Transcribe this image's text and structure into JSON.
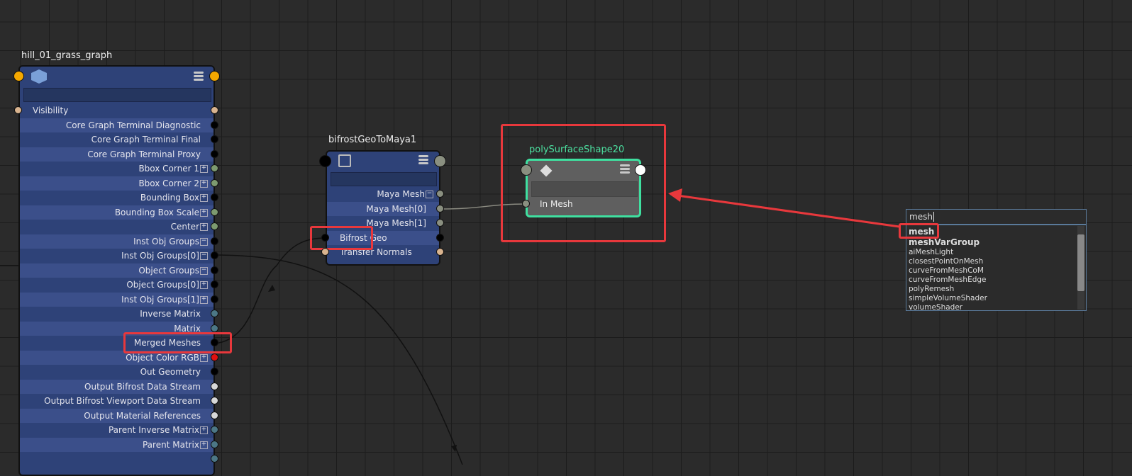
{
  "nodes": {
    "graph": {
      "title": "hill_01_grass_graph",
      "rows": [
        {
          "label": "Visibility",
          "port": "#d9b48f",
          "align": "left"
        },
        {
          "label": "Core Graph Terminal Diagnostic",
          "port": "#000000"
        },
        {
          "label": "Core Graph Terminal Final",
          "port": "#000000"
        },
        {
          "label": "Core Graph Terminal Proxy",
          "port": "#000000"
        },
        {
          "label": "Bbox Corner 1",
          "port": "#7d9a70",
          "exp": "+"
        },
        {
          "label": "Bbox Corner 2",
          "port": "#7d9a70",
          "exp": "+"
        },
        {
          "label": "Bounding Box",
          "port": "#000000",
          "exp": "+"
        },
        {
          "label": "Bounding Box Scale",
          "port": "#7d9a70",
          "exp": "+"
        },
        {
          "label": "Center",
          "port": "#7d9a70",
          "exp": "+"
        },
        {
          "label": "Inst Obj Groups",
          "port": "#000000",
          "exp": "−"
        },
        {
          "label": "Inst Obj Groups[0]",
          "port": "#000000",
          "exp": "−"
        },
        {
          "label": "Object Groups",
          "port": "#000000",
          "exp": "−"
        },
        {
          "label": "Object Groups[0]",
          "port": "#000000",
          "exp": "+"
        },
        {
          "label": "Inst Obj Groups[1]",
          "port": "#000000",
          "exp": "+"
        },
        {
          "label": "Inverse Matrix",
          "port": "#4c7786"
        },
        {
          "label": "Matrix",
          "port": "#4c7786"
        },
        {
          "label": "Merged Meshes",
          "port": "#000000"
        },
        {
          "label": "Object Color RGB",
          "port": "#e01010",
          "exp": "+"
        },
        {
          "label": "Out Geometry",
          "port": "#000000"
        },
        {
          "label": "Output Bifrost Data Stream",
          "port": "#d8d8d8"
        },
        {
          "label": "Output Bifrost Viewport Data Stream",
          "port": "#d8d8d8"
        },
        {
          "label": "Output Material References",
          "port": "#d8d8d8"
        },
        {
          "label": "Parent Inverse Matrix",
          "port": "#4c7786",
          "exp": "+"
        },
        {
          "label": "Parent Matrix",
          "port": "#4c7786",
          "exp": "+"
        },
        {
          "label": "",
          "port": "#4c7786"
        }
      ]
    },
    "bifrost": {
      "title": "bifrostGeoToMaya1",
      "rows": [
        {
          "label": "Maya Mesh",
          "port": "#8a8f80",
          "exp": "−"
        },
        {
          "label": "Maya Mesh[0]",
          "port": "#8a8f80"
        },
        {
          "label": "Maya Mesh[1]",
          "port": "#8a8f80"
        },
        {
          "label": "Bifrost Geo",
          "port": "#000000",
          "inport": "#000000",
          "align": "left"
        },
        {
          "label": "Transfer Normals",
          "port": "#d9b48f",
          "inport": "#d9b48f",
          "align": "left"
        }
      ]
    },
    "poly": {
      "title": "polySurfaceShape20",
      "title_color": "#4ce0a0",
      "border_color": "#3fe0a0",
      "rows": [
        {
          "label": "In Mesh"
        }
      ]
    }
  },
  "search": {
    "value": "mesh",
    "results": [
      "mesh",
      "meshVarGroup",
      "aiMeshLight",
      "closestPointOnMesh",
      "curveFromMeshCoM",
      "curveFromMeshEdge",
      "polyRemesh",
      "simpleVolumeShader",
      "volumeShader"
    ]
  },
  "colors": {
    "highlight": "#e8383c",
    "background": "#2b2b2b"
  }
}
